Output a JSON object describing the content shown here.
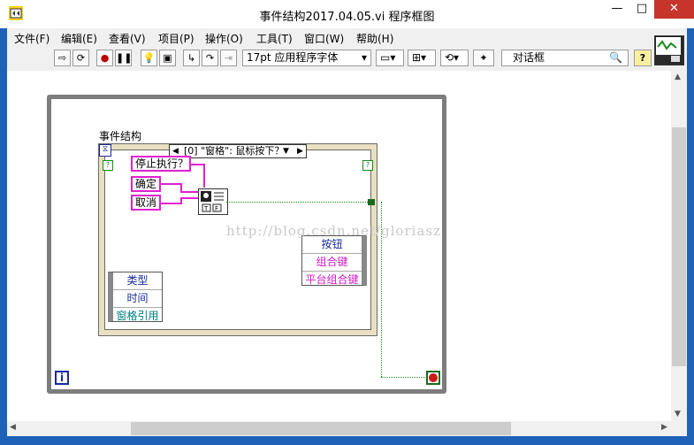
{
  "window": {
    "title": "事件结构2017.04.05.vi 程序框图",
    "minimize": "—",
    "maximize": "□",
    "close": "✕"
  },
  "menu": [
    "文件(F)",
    "编辑(E)",
    "查看(V)",
    "项目(P)",
    "操作(O)",
    "工具(T)",
    "窗口(W)",
    "帮助(H)"
  ],
  "toolbar": {
    "font_select": "17pt 应用程序字体",
    "search_value": "对话框",
    "help": "?"
  },
  "diagram": {
    "event_structure_label": "事件结构",
    "case_selector": "[0] \"窗格\": 鼠标按下？",
    "stop_prompt": "停止执行？",
    "ok_label": "确定",
    "cancel_label": "取消",
    "event_data_left": [
      "类型",
      "时间",
      "窗格引用"
    ],
    "event_data_right": [
      "按钮",
      "组合键",
      "平台组合键"
    ],
    "info_badge": "i"
  },
  "watermark": "http://blog.csdn.net/gloriasz",
  "colors": {
    "pink_wire": "#e020d0",
    "bool_wire": "#1a8a1a",
    "blue_text": "#1a2a9a"
  }
}
